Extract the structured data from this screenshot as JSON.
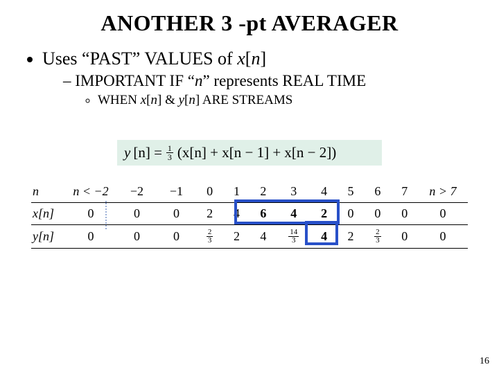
{
  "title": "ANOTHER 3 -pt AVERAGER",
  "bullet1_a": "Uses “PAST” VALUES of ",
  "bullet1_b": "x",
  "bullet1_c": "[",
  "bullet1_d": "n",
  "bullet1_e": "]",
  "bullet2_a": "IMPORTANT IF “",
  "bullet2_b": "n",
  "bullet2_c": "” represents REAL TIME",
  "bullet3_a": "WHEN ",
  "bullet3_b": "x",
  "bullet3_c": "[",
  "bullet3_d": "n",
  "bullet3_e": "] & ",
  "bullet3_f": "y",
  "bullet3_g": "[",
  "bullet3_h": "n",
  "bullet3_i": "] ARE STREAMS",
  "formula": {
    "lhs_y": "y",
    "lhs_br": "[n] =",
    "frac_num": "1",
    "frac_den": "3",
    "rhs": "(x[n] + x[n − 1] + x[n − 2])"
  },
  "table": {
    "row_n": {
      "label": "n",
      "c1": "n < −2",
      "c2": "−2",
      "c3": "−1",
      "c4": "0",
      "c5": "1",
      "c6": "2",
      "c7": "3",
      "c8": "4",
      "c9": "5",
      "c10": "6",
      "c11": "7",
      "c12": "n > 7"
    },
    "row_x": {
      "label": "x[n]",
      "c1": "0",
      "c2": "0",
      "c3": "0",
      "c4": "2",
      "c5": "4",
      "c6": "6",
      "c7": "4",
      "c8": "2",
      "c9": "0",
      "c10": "0",
      "c11": "0",
      "c12": "0"
    },
    "row_y": {
      "label": "y[n]",
      "c1": "0",
      "c2": "0",
      "c3": "0",
      "c4": {
        "num": "2",
        "den": "3"
      },
      "c5": "2",
      "c6": "4",
      "c7": {
        "num": "14",
        "den": "3"
      },
      "c8": "4",
      "c9": "2",
      "c10": {
        "num": "2",
        "den": "3"
      },
      "c11": "0",
      "c12": "0"
    }
  },
  "chart_data": {
    "type": "table",
    "title": "ANOTHER 3-pt AVERAGER",
    "columns": [
      "n",
      "n<-2",
      "-2",
      "-1",
      "0",
      "1",
      "2",
      "3",
      "4",
      "5",
      "6",
      "7",
      "n>7"
    ],
    "series": [
      {
        "name": "x[n]",
        "values": [
          0,
          0,
          0,
          2,
          4,
          6,
          4,
          2,
          0,
          0,
          0,
          0
        ]
      },
      {
        "name": "y[n]",
        "values": [
          0,
          0,
          0,
          0.6667,
          2,
          4,
          4.6667,
          4,
          2,
          0.6667,
          0,
          0
        ]
      }
    ],
    "highlight_x_indices": [
      2,
      3,
      4
    ],
    "highlight_y_index": 4
  },
  "page_number": "16"
}
